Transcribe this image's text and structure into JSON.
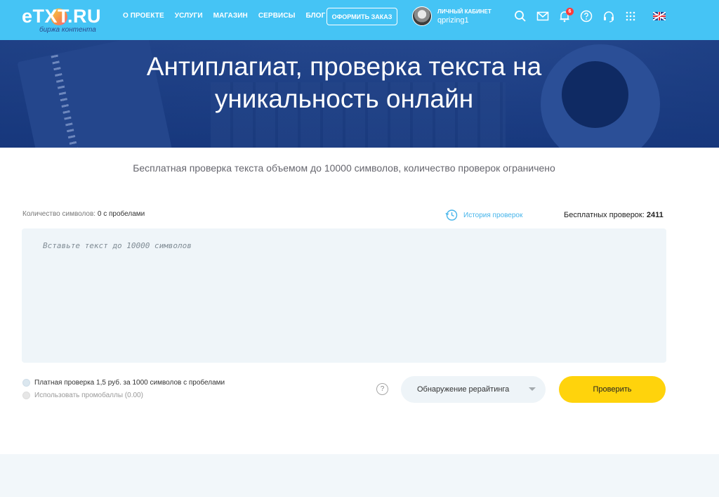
{
  "header": {
    "logo_text": "eTXT.RU",
    "logo_subtitle": "биржа контента",
    "nav": [
      "О проекте",
      "Услуги",
      "Магазин",
      "Сервисы",
      "Блог"
    ],
    "order_button": "Оформить заказ",
    "cabinet_label": "Личный кабинет",
    "username": "qprizing1",
    "notification_count": "6",
    "icons": [
      "search-icon",
      "mail-icon",
      "bell-icon",
      "help-icon",
      "headset-icon",
      "apps-grid-icon",
      "uk-flag-icon"
    ],
    "accent_color": "#45c4f5"
  },
  "hero": {
    "title": "Антиплагиат, проверка текста на уникальность онлайн"
  },
  "main": {
    "subtitle": "Бесплатная проверка текста объемом до 10000 символов, количество проверок ограничено",
    "char_count_label": "Количество символов:",
    "char_count_value": "0 с пробелами",
    "history_label": "История проверок",
    "free_checks_label": "Бесплатных проверок:",
    "free_checks_value": "2411",
    "textarea_placeholder": "Вставьте текст до 10000 символов",
    "option_paid": "Платная проверка 1,5 руб. за 1000 символов с пробелами",
    "option_promo": "Использовать промобаллы (0.00)",
    "help_symbol": "?",
    "mode_select": "Обнаружение рерайтинга",
    "check_button": "Проверить",
    "button_color": "#ffd30c"
  }
}
